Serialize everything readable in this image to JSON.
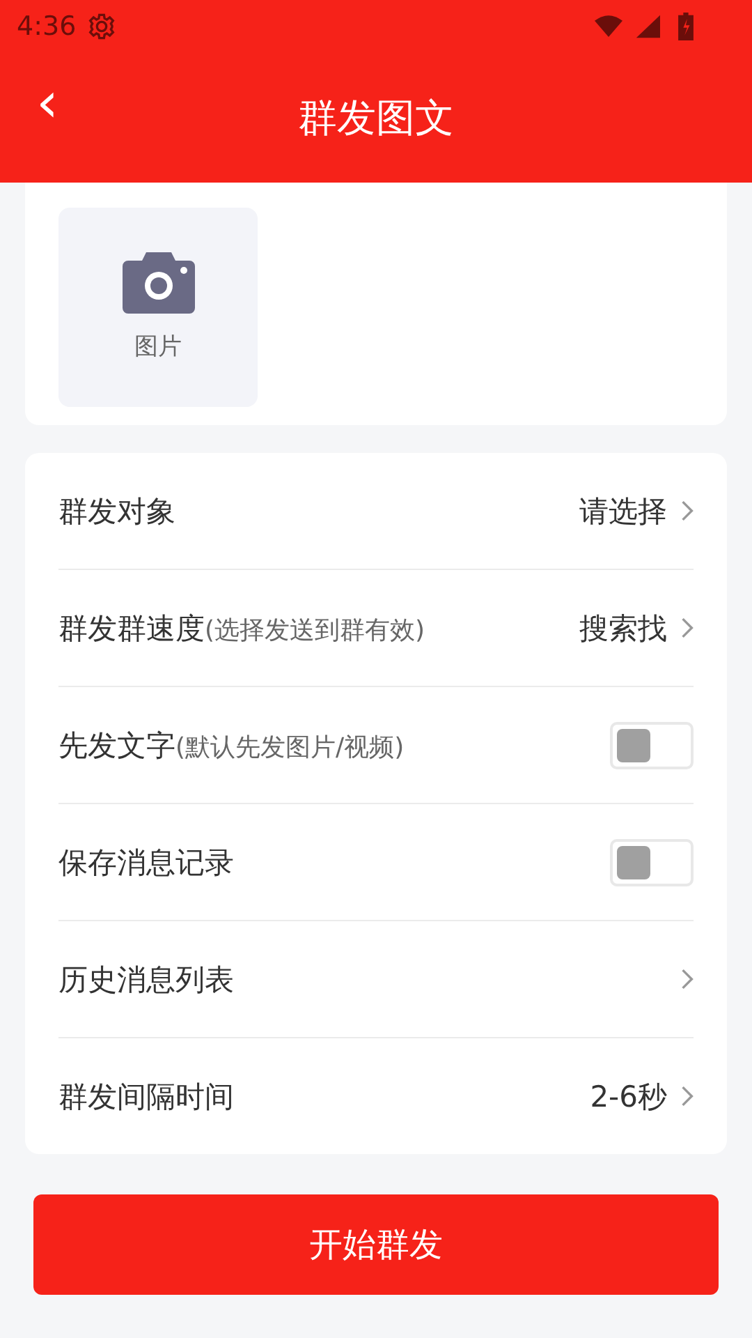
{
  "status_bar": {
    "time": "4:36"
  },
  "header": {
    "title": "群发图文",
    "back": "‹"
  },
  "media": {
    "label": "图片"
  },
  "settings": [
    {
      "kind": "select",
      "label": "群发对象",
      "value": "请选择"
    },
    {
      "kind": "select",
      "label": "群发群速度",
      "hint": "(选择发送到群有效)",
      "value": "搜索找"
    },
    {
      "kind": "toggle",
      "label": "先发文字",
      "hint": "(默认先发图片/视频)",
      "on": false
    },
    {
      "kind": "toggle",
      "label": "保存消息记录",
      "on": false
    },
    {
      "kind": "link",
      "label": "历史消息列表"
    },
    {
      "kind": "select",
      "label": "群发间隔时间",
      "value": "2-6秒"
    }
  ],
  "primary_button": {
    "label": "开始群发"
  }
}
